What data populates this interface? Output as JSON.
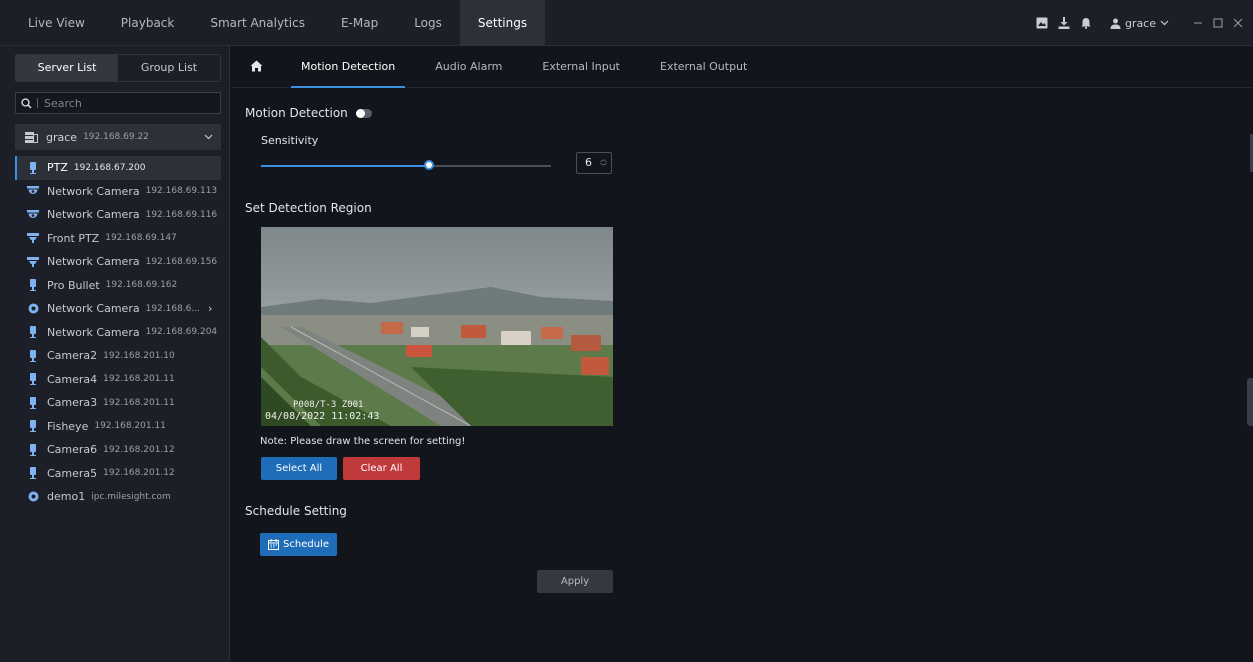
{
  "topnav": {
    "tabs": [
      {
        "label": "Live View"
      },
      {
        "label": "Playback"
      },
      {
        "label": "Smart Analytics"
      },
      {
        "label": "E-Map"
      },
      {
        "label": "Logs"
      },
      {
        "label": "Settings"
      }
    ],
    "active_tab": "Settings",
    "user": "grace"
  },
  "sidebar": {
    "tabs": [
      {
        "label": "Server List"
      },
      {
        "label": "Group List"
      }
    ],
    "search_placeholder": "Search",
    "server": {
      "name": "grace",
      "ip": "192.168.69.22"
    },
    "devices": [
      {
        "name": "PTZ",
        "ip": "192.168.67.200",
        "icon": "bullet-camera-icon"
      },
      {
        "name": "Network Camera",
        "ip": "192.168.69.113",
        "icon": "dome-camera-icon"
      },
      {
        "name": "Network Camera",
        "ip": "192.168.69.116",
        "icon": "dome-camera-icon"
      },
      {
        "name": "Front PTZ",
        "ip": "192.168.69.147",
        "icon": "ptz-camera-icon"
      },
      {
        "name": "Network Camera",
        "ip": "192.168.69.156",
        "icon": "ptz-camera-icon"
      },
      {
        "name": "Pro Bullet",
        "ip": "192.168.69.162",
        "icon": "bullet-camera-icon"
      },
      {
        "name": "Network Camera",
        "ip": "192.168.6...",
        "icon": "fisheye-camera-icon"
      },
      {
        "name": "Network Camera",
        "ip": "192.168.69.204",
        "icon": "bullet-camera-icon"
      },
      {
        "name": "Camera2",
        "ip": "192.168.201.10",
        "icon": "bullet-camera-icon"
      },
      {
        "name": "Camera4",
        "ip": "192.168.201.11",
        "icon": "bullet-camera-icon"
      },
      {
        "name": "Camera3",
        "ip": "192.168.201.11",
        "icon": "bullet-camera-icon"
      },
      {
        "name": "Fisheye",
        "ip": "192.168.201.11",
        "icon": "bullet-camera-icon"
      },
      {
        "name": "Camera6",
        "ip": "192.168.201.12",
        "icon": "bullet-camera-icon"
      },
      {
        "name": "Camera5",
        "ip": "192.168.201.12",
        "icon": "bullet-camera-icon"
      },
      {
        "name": "demo1",
        "ip": "ipc.milesight.com",
        "icon": "fisheye-camera-icon"
      }
    ],
    "selected_index": 0
  },
  "subtabs": [
    {
      "label": "Motion Detection"
    },
    {
      "label": "Audio Alarm"
    },
    {
      "label": "External Input"
    },
    {
      "label": "External Output"
    }
  ],
  "motion": {
    "title": "Motion Detection",
    "sensitivity_label": "Sensitivity",
    "sensitivity_value": "6",
    "slider_fraction": 0.58,
    "region_title": "Set Detection Region",
    "overlay_camera": "P008/T-3   Z001",
    "overlay_time": "04/08/2022 11:02:43",
    "note": "Note: Please draw the screen for setting!",
    "select_all": "Select All",
    "clear_all": "Clear All",
    "schedule_title": "Schedule Setting",
    "schedule_button": "Schedule",
    "apply": "Apply"
  },
  "colors": {
    "accent": "#3d8fe0",
    "danger": "#c0393b",
    "primary_button": "#1f6db8"
  }
}
